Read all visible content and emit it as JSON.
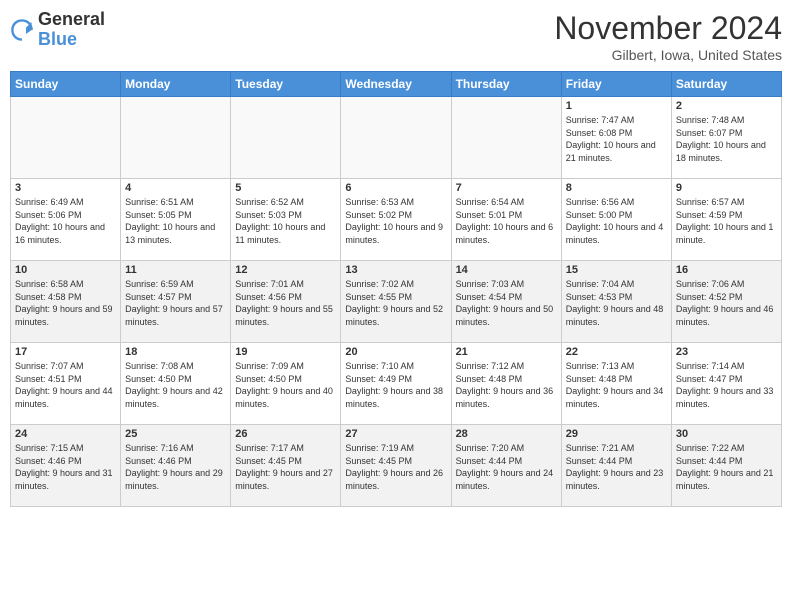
{
  "header": {
    "logo_line1": "General",
    "logo_line2": "Blue",
    "month_title": "November 2024",
    "location": "Gilbert, Iowa, United States"
  },
  "days_of_week": [
    "Sunday",
    "Monday",
    "Tuesday",
    "Wednesday",
    "Thursday",
    "Friday",
    "Saturday"
  ],
  "weeks": [
    [
      {
        "day": "",
        "info": ""
      },
      {
        "day": "",
        "info": ""
      },
      {
        "day": "",
        "info": ""
      },
      {
        "day": "",
        "info": ""
      },
      {
        "day": "",
        "info": ""
      },
      {
        "day": "1",
        "info": "Sunrise: 7:47 AM\nSunset: 6:08 PM\nDaylight: 10 hours and 21 minutes."
      },
      {
        "day": "2",
        "info": "Sunrise: 7:48 AM\nSunset: 6:07 PM\nDaylight: 10 hours and 18 minutes."
      }
    ],
    [
      {
        "day": "3",
        "info": "Sunrise: 6:49 AM\nSunset: 5:06 PM\nDaylight: 10 hours and 16 minutes."
      },
      {
        "day": "4",
        "info": "Sunrise: 6:51 AM\nSunset: 5:05 PM\nDaylight: 10 hours and 13 minutes."
      },
      {
        "day": "5",
        "info": "Sunrise: 6:52 AM\nSunset: 5:03 PM\nDaylight: 10 hours and 11 minutes."
      },
      {
        "day": "6",
        "info": "Sunrise: 6:53 AM\nSunset: 5:02 PM\nDaylight: 10 hours and 9 minutes."
      },
      {
        "day": "7",
        "info": "Sunrise: 6:54 AM\nSunset: 5:01 PM\nDaylight: 10 hours and 6 minutes."
      },
      {
        "day": "8",
        "info": "Sunrise: 6:56 AM\nSunset: 5:00 PM\nDaylight: 10 hours and 4 minutes."
      },
      {
        "day": "9",
        "info": "Sunrise: 6:57 AM\nSunset: 4:59 PM\nDaylight: 10 hours and 1 minute."
      }
    ],
    [
      {
        "day": "10",
        "info": "Sunrise: 6:58 AM\nSunset: 4:58 PM\nDaylight: 9 hours and 59 minutes."
      },
      {
        "day": "11",
        "info": "Sunrise: 6:59 AM\nSunset: 4:57 PM\nDaylight: 9 hours and 57 minutes."
      },
      {
        "day": "12",
        "info": "Sunrise: 7:01 AM\nSunset: 4:56 PM\nDaylight: 9 hours and 55 minutes."
      },
      {
        "day": "13",
        "info": "Sunrise: 7:02 AM\nSunset: 4:55 PM\nDaylight: 9 hours and 52 minutes."
      },
      {
        "day": "14",
        "info": "Sunrise: 7:03 AM\nSunset: 4:54 PM\nDaylight: 9 hours and 50 minutes."
      },
      {
        "day": "15",
        "info": "Sunrise: 7:04 AM\nSunset: 4:53 PM\nDaylight: 9 hours and 48 minutes."
      },
      {
        "day": "16",
        "info": "Sunrise: 7:06 AM\nSunset: 4:52 PM\nDaylight: 9 hours and 46 minutes."
      }
    ],
    [
      {
        "day": "17",
        "info": "Sunrise: 7:07 AM\nSunset: 4:51 PM\nDaylight: 9 hours and 44 minutes."
      },
      {
        "day": "18",
        "info": "Sunrise: 7:08 AM\nSunset: 4:50 PM\nDaylight: 9 hours and 42 minutes."
      },
      {
        "day": "19",
        "info": "Sunrise: 7:09 AM\nSunset: 4:50 PM\nDaylight: 9 hours and 40 minutes."
      },
      {
        "day": "20",
        "info": "Sunrise: 7:10 AM\nSunset: 4:49 PM\nDaylight: 9 hours and 38 minutes."
      },
      {
        "day": "21",
        "info": "Sunrise: 7:12 AM\nSunset: 4:48 PM\nDaylight: 9 hours and 36 minutes."
      },
      {
        "day": "22",
        "info": "Sunrise: 7:13 AM\nSunset: 4:48 PM\nDaylight: 9 hours and 34 minutes."
      },
      {
        "day": "23",
        "info": "Sunrise: 7:14 AM\nSunset: 4:47 PM\nDaylight: 9 hours and 33 minutes."
      }
    ],
    [
      {
        "day": "24",
        "info": "Sunrise: 7:15 AM\nSunset: 4:46 PM\nDaylight: 9 hours and 31 minutes."
      },
      {
        "day": "25",
        "info": "Sunrise: 7:16 AM\nSunset: 4:46 PM\nDaylight: 9 hours and 29 minutes."
      },
      {
        "day": "26",
        "info": "Sunrise: 7:17 AM\nSunset: 4:45 PM\nDaylight: 9 hours and 27 minutes."
      },
      {
        "day": "27",
        "info": "Sunrise: 7:19 AM\nSunset: 4:45 PM\nDaylight: 9 hours and 26 minutes."
      },
      {
        "day": "28",
        "info": "Sunrise: 7:20 AM\nSunset: 4:44 PM\nDaylight: 9 hours and 24 minutes."
      },
      {
        "day": "29",
        "info": "Sunrise: 7:21 AM\nSunset: 4:44 PM\nDaylight: 9 hours and 23 minutes."
      },
      {
        "day": "30",
        "info": "Sunrise: 7:22 AM\nSunset: 4:44 PM\nDaylight: 9 hours and 21 minutes."
      }
    ]
  ]
}
